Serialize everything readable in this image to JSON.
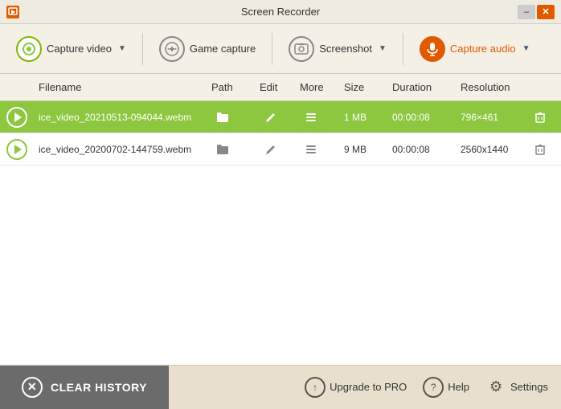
{
  "titlebar": {
    "icon_color": "#e05a00",
    "title": "Screen Recorder",
    "minimize_label": "–",
    "close_label": "✕"
  },
  "toolbar": {
    "capture_video_label": "Capture video",
    "game_capture_label": "Game capture",
    "screenshot_label": "Screenshot",
    "capture_audio_label": "Capture audio"
  },
  "table": {
    "columns": {
      "play": "",
      "filename": "Filename",
      "path": "Path",
      "edit": "Edit",
      "more": "More",
      "size": "Size",
      "duration": "Duration",
      "resolution": "Resolution",
      "delete": ""
    },
    "rows": [
      {
        "filename": "ice_video_20210513-094044.webm",
        "size": "1 MB",
        "duration": "00:00:08",
        "resolution": "796×461",
        "highlighted": true
      },
      {
        "filename": "ice_video_20200702-144759.webm",
        "size": "9 MB",
        "duration": "00:00:08",
        "resolution": "2560x1440",
        "highlighted": false
      }
    ]
  },
  "bottom": {
    "clear_history_label": "CLEAR HISTORY",
    "upgrade_label": "Upgrade to PRO",
    "help_label": "Help",
    "settings_label": "Settings"
  }
}
